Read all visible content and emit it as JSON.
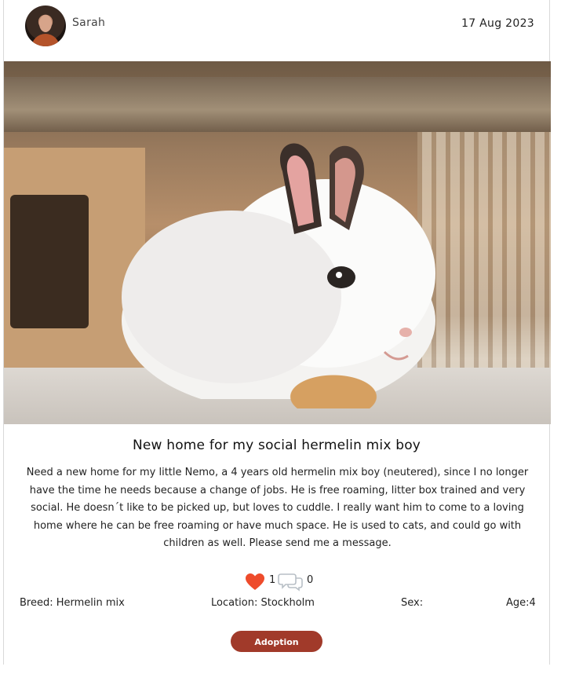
{
  "post": {
    "author": "Sarah",
    "date": "17 Aug 2023",
    "title": "New home for my social hermelin mix boy",
    "description": "Need a new home for my little Nemo, a 4 years old hermelin mix boy (neutered), since I no longer have the time he needs because a change of jobs. He is free roaming, litter box trained and very social. He doesn´t like to be picked up, but loves to cuddle. I really want him to come to a loving home where he can be free roaming or have much space. He is used to cats, and could go with children as well. Please send me a message.",
    "likes": "1",
    "comments": "0",
    "breed": "Breed: Hermelin mix",
    "location": "Location: Stockholm",
    "sex": "Sex:",
    "age": "Age:4",
    "adopt_label": "Adoption Request"
  },
  "icons": {
    "like": "heart-icon",
    "comment": "comment-icon"
  },
  "colors": {
    "heart": "#ee4b2b",
    "button": "#a13a2a"
  }
}
